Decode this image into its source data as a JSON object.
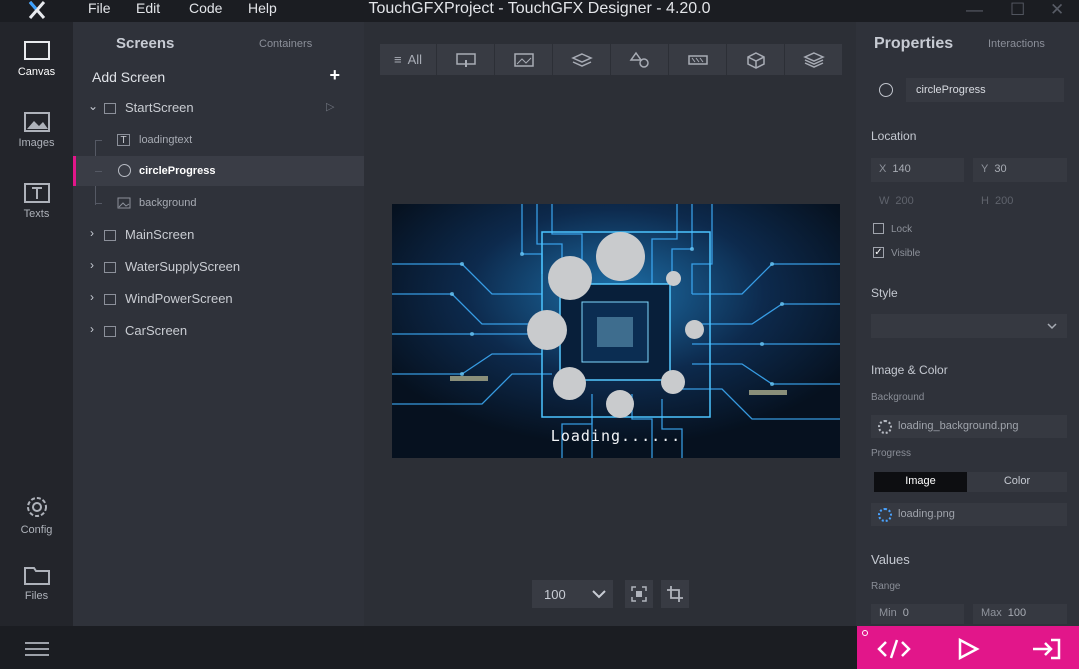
{
  "colors": {
    "accent": "#e2168a",
    "titlebar": "#1b1d22",
    "panel": "#2f323a",
    "canvas_bg": "#2c2f36",
    "selected": "#3a3d46"
  },
  "menu": {
    "file": "File",
    "edit": "Edit",
    "code": "Code",
    "help": "Help"
  },
  "window": {
    "title": "TouchGFXProject - TouchGFX Designer - 4.20.0"
  },
  "rail": {
    "canvas": "Canvas",
    "images": "Images",
    "texts": "Texts",
    "config": "Config",
    "files": "Files"
  },
  "tree": {
    "tab_screens": "Screens",
    "tab_containers": "Containers",
    "add_screen": "Add Screen",
    "start": "StartScreen",
    "child_text": "loadingtext",
    "child_progress": "circleProgress",
    "child_bg": "background",
    "main": "MainScreen",
    "water": "WaterSupplyScreen",
    "wind": "WindPowerScreen",
    "car": "CarScreen"
  },
  "toolbar": {
    "all": "All"
  },
  "preview": {
    "loading_text": "Loading......"
  },
  "zoom": {
    "value": "100"
  },
  "props": {
    "tab_properties": "Properties",
    "tab_interactions": "Interactions",
    "name": "circleProgress",
    "location": "Location",
    "x_label": "X",
    "x": "140",
    "y_label": "Y",
    "y": "30",
    "w_label": "W",
    "w": "200",
    "h_label": "H",
    "h": "200",
    "lock": "Lock",
    "visible": "Visible",
    "style": "Style",
    "image_color": "Image & Color",
    "background": "Background",
    "background_file": "loading_background.png",
    "progress": "Progress",
    "seg_image": "Image",
    "seg_color": "Color",
    "progress_file": "loading.png",
    "values": "Values",
    "range": "Range",
    "min_label": "Min",
    "min": "0",
    "max_label": "Max",
    "max": "100"
  }
}
